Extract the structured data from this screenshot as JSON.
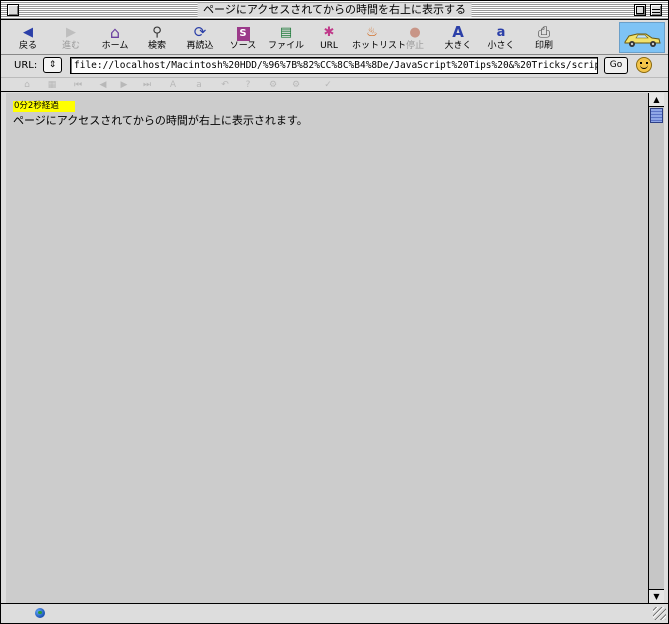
{
  "window": {
    "title": "ページにアクセスされてからの時間を右上に表示する"
  },
  "toolbar": {
    "buttons": [
      {
        "label": "戻る",
        "icon": "back-arrow-icon",
        "glyph": "◀",
        "enabled": true
      },
      {
        "label": "進む",
        "icon": "forward-arrow-icon",
        "glyph": "▶",
        "enabled": false
      },
      {
        "label": "ホーム",
        "icon": "home-icon",
        "glyph": "⌂",
        "enabled": true
      },
      {
        "label": "検索",
        "icon": "search-icon",
        "glyph": "⚲",
        "enabled": true
      },
      {
        "label": "再読込",
        "icon": "reload-icon",
        "glyph": "⟳",
        "enabled": true
      },
      {
        "label": "ソース",
        "icon": "source-icon",
        "glyph": "S",
        "enabled": true
      },
      {
        "label": "ファイル",
        "icon": "file-icon",
        "glyph": "▤",
        "enabled": true
      },
      {
        "label": "URL",
        "icon": "url-icon",
        "glyph": "✱",
        "enabled": true
      },
      {
        "label": "ホットリスト",
        "icon": "hotlist-icon",
        "glyph": "♨",
        "enabled": true
      },
      {
        "label": "停止",
        "icon": "stop-icon",
        "glyph": "●",
        "enabled": false
      },
      {
        "label": "大きく",
        "icon": "larger-text-icon",
        "glyph": "A",
        "enabled": true
      },
      {
        "label": "小さく",
        "icon": "smaller-text-icon",
        "glyph": "a",
        "enabled": true
      },
      {
        "label": "印刷",
        "icon": "print-icon",
        "glyph": "⎙",
        "enabled": true
      }
    ]
  },
  "address": {
    "label": "URL:",
    "stepper": "⇕",
    "value": "file://localhost/Macintosh%20HDD/%96%7B%82%CC%8C%B4%8De/JavaScript%20Tips%20&%20Tricks/scrip",
    "go_label": "Go"
  },
  "secondary_bar": {
    "glyphs": [
      "⌂",
      "▦",
      "⏮",
      "◀",
      "▶",
      "⏭",
      "A",
      "a",
      "↶",
      "?",
      "⚙",
      "⚙",
      "✓"
    ]
  },
  "page": {
    "elapsed_label": "0分2秒経過",
    "body_text": "ページにアクセスされてからの時間が右上に表示されます。"
  },
  "colors": {
    "highlight": "#ffff00",
    "content_bg": "#cccccc",
    "chrome_bg": "#dddddd"
  }
}
